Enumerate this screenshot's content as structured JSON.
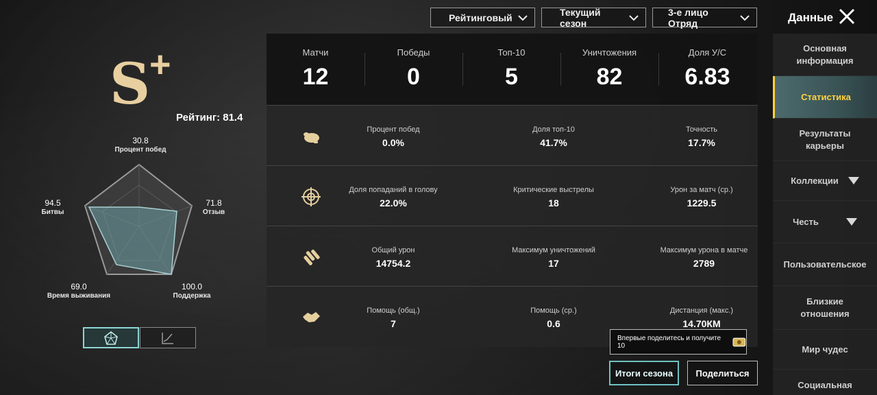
{
  "filters": {
    "mode": "Рейтинговый",
    "season": "Текущий сезон",
    "perspective": "3-е лицо Отряд"
  },
  "header": {
    "title": "Данные"
  },
  "rank": {
    "tier": "S",
    "plus": "+",
    "rating_label": "Рейтинг: 81.4",
    "accent_color": "#e8cfa0"
  },
  "radar": {
    "win_rate": {
      "value": "30.8",
      "name": "Процент побед"
    },
    "feedback": {
      "value": "71.8",
      "name": "Отзыв"
    },
    "support": {
      "value": "100.0",
      "name": "Поддержка"
    },
    "survival": {
      "value": "69.0",
      "name": "Время выживания"
    },
    "battles": {
      "value": "94.5",
      "name": "Битвы"
    }
  },
  "summary": [
    {
      "label": "Матчи",
      "value": "12"
    },
    {
      "label": "Победы",
      "value": "0"
    },
    {
      "label": "Топ-10",
      "value": "5"
    },
    {
      "label": "Уничтожения",
      "value": "82"
    },
    {
      "label": "Доля У/С",
      "value": "6.83"
    }
  ],
  "rows": [
    {
      "icon": "chicken-icon",
      "cells": [
        {
          "label": "Процент побед",
          "value": "0.0%"
        },
        {
          "label": "Доля топ-10",
          "value": "41.7%"
        },
        {
          "label": "Точность",
          "value": "17.7%"
        }
      ]
    },
    {
      "icon": "crosshair-icon",
      "cells": [
        {
          "label": "Доля попаданий в голову",
          "value": "22.0%"
        },
        {
          "label": "Критические выстрелы",
          "value": "18"
        },
        {
          "label": "Урон за матч (ср.)",
          "value": "1229.5"
        }
      ]
    },
    {
      "icon": "bullets-icon",
      "cells": [
        {
          "label": "Общий урон",
          "value": "14754.2"
        },
        {
          "label": "Максимум уничтожений",
          "value": "17"
        },
        {
          "label": "Максимум урона в матче",
          "value": "2789"
        }
      ]
    },
    {
      "icon": "handshake-icon",
      "cells": [
        {
          "label": "Помощь (общ.)",
          "value": "7"
        },
        {
          "label": "Помощь (ср.)",
          "value": "0.6"
        },
        {
          "label": "Дистанция (макс.)",
          "value": "14.70КМ"
        }
      ]
    }
  ],
  "tooltip": {
    "text": "Впервые поделитесь и получите 10"
  },
  "buttons": {
    "season_summary": "Итоги сезона",
    "share": "Поделиться"
  },
  "sidebar": {
    "items": [
      {
        "label": "Основная информация"
      },
      {
        "label": "Статистика"
      },
      {
        "label": "Результаты карьеры"
      },
      {
        "label": "Коллекции"
      },
      {
        "label": "Честь"
      },
      {
        "label": "Пользовательское"
      },
      {
        "label": "Близкие отношения"
      },
      {
        "label": "Мир чудес"
      },
      {
        "label": "Социальная"
      }
    ]
  },
  "colors": {
    "accent_teal": "#6fc2c2",
    "active_tab_text": "#ffd23f"
  }
}
